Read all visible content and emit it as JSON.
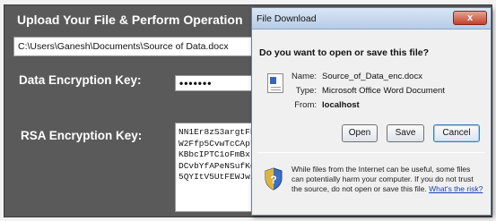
{
  "app": {
    "title": "Upload Your File & Perform Operation",
    "file_path": "C:\\Users\\Ganesh\\Documents\\Source of Data.docx",
    "data_key_label": "Data Encryption Key:",
    "data_key_value": "•••••••",
    "rsa_key_label": "RSA Encryption Key:",
    "rsa_key_lines": [
      "NN1Er8zS3argtFh",
      "W2Ffp5CvwTcCApt",
      "KBbcIPTC1oFmBxr",
      "DCvbYfAPeNSufKd",
      "5QYItV5UtFEWJwi"
    ]
  },
  "dialog": {
    "title": "File Download",
    "close_label": "x",
    "question": "Do you want to open or save this file?",
    "name_label": "Name:",
    "name_value": "Source_of_Data_enc.docx",
    "type_label": "Type:",
    "type_value": "Microsoft Office Word Document",
    "from_label": "From:",
    "from_value": "localhost",
    "open_label": "Open",
    "save_label": "Save",
    "cancel_label": "Cancel",
    "warning_text": "While files from the Internet can be useful, some files can potentially harm your computer. If you do not trust the source, do not open or save this file.",
    "risk_link": "What's the risk?"
  },
  "colors": {
    "panel_bg": "#5a5a5a",
    "dialog_titlebar": "#c6d7ee",
    "link": "#1a3fb5",
    "close_button": "#c3412c"
  }
}
